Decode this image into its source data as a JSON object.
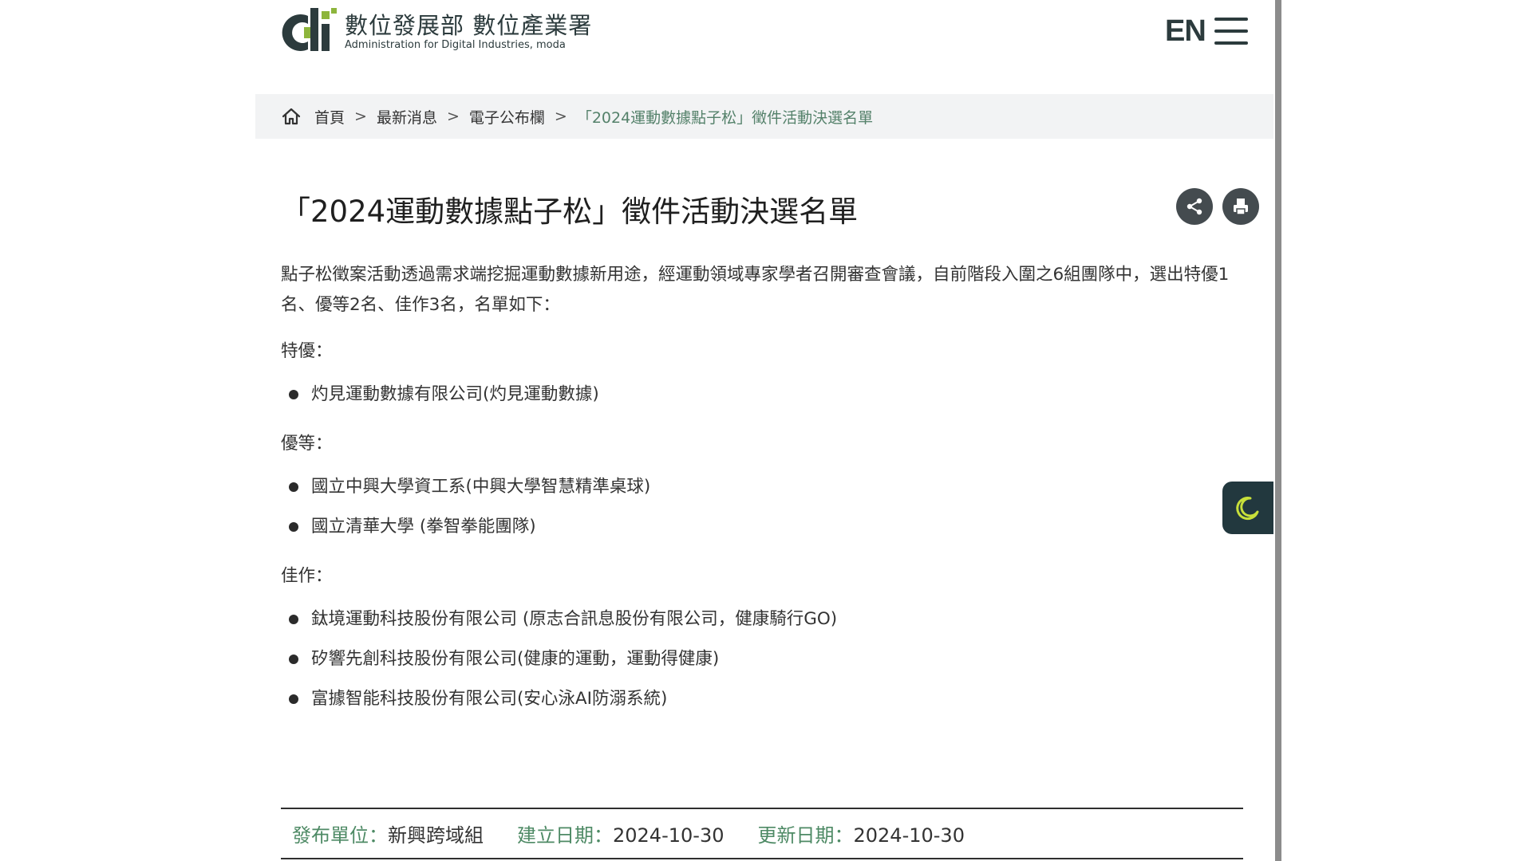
{
  "header": {
    "logo_name_cn": "數位發展部 數位產業署",
    "logo_name_en": "Administration for Digital Industries, moda",
    "language_toggle": "EN",
    "brand_colors": {
      "dark": "#2c3b3d",
      "accent_green": "#8db53c"
    }
  },
  "breadcrumb": {
    "items": [
      "首頁",
      "最新消息",
      "電子公布欄"
    ],
    "separator": ">",
    "current": "「2024運動數據點子松」徵件活動決選名單"
  },
  "article": {
    "title": "「2024運動數據點子松」徵件活動決選名單",
    "share_icon": "share-icon",
    "print_icon": "print-icon",
    "intro": "點子松徵案活動透過需求端挖掘運動數據新用途，經運動領域專家學者召開審查會議，自前階段入圍之6組團隊中，選出特優1名、優等2名、佳作3名，名單如下：",
    "sections": [
      {
        "label": "特優：",
        "items": [
          "灼見運動數據有限公司(灼見運動數據)"
        ]
      },
      {
        "label": "優等：",
        "items": [
          "國立中興大學資工系(中興大學智慧精準桌球)",
          "國立清華大學 (拳智拳能團隊)"
        ]
      },
      {
        "label": "佳作：",
        "items": [
          "鈦境運動科技股份有限公司 (原志合訊息股份有限公司，健康騎行GO)",
          "矽響先創科技股份有限公司(健康的運動，運動得健康)",
          "富據智能科技股份有限公司(安心泳AI防溺系統)"
        ]
      }
    ]
  },
  "meta": {
    "publisher_label": "發布單位：",
    "publisher": "新興跨域組",
    "created_label": "建立日期：",
    "created": "2024-10-30",
    "updated_label": "更新日期：",
    "updated": "2024-10-30"
  },
  "dark_mode_icon": "moon-icon"
}
